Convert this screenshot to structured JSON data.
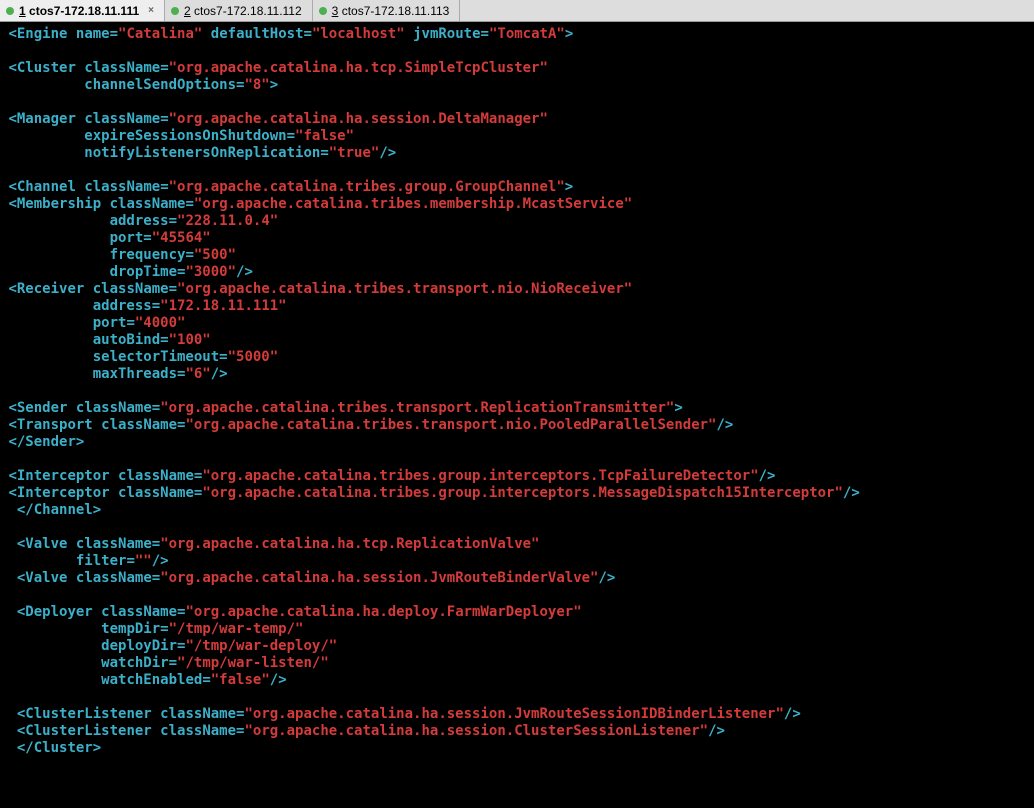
{
  "tabs": [
    {
      "num": "1",
      "label": "ctos7-172.18.11.111",
      "active": true,
      "close": true
    },
    {
      "num": "2",
      "label": "ctos7-172.18.11.112",
      "active": false,
      "close": false
    },
    {
      "num": "3",
      "label": "ctos7-172.18.11.113",
      "active": false,
      "close": false
    }
  ],
  "code": {
    "l01": {
      "tag": "Engine",
      "a1": "name",
      "v1": "\"Catalina\"",
      "a2": "defaultHost",
      "v2": "\"localhost\"",
      "a3": "jvmRoute",
      "v3": "\"TomcatA\""
    },
    "l03": {
      "tag": "Cluster",
      "a1": "className",
      "v1": "\"org.apache.catalina.ha.tcp.SimpleTcpCluster\""
    },
    "l04": {
      "a1": "channelSendOptions",
      "v1": "\"8\""
    },
    "l06": {
      "tag": "Manager",
      "a1": "className",
      "v1": "\"org.apache.catalina.ha.session.DeltaManager\""
    },
    "l07": {
      "a1": "expireSessionsOnShutdown",
      "v1": "\"false\""
    },
    "l08": {
      "a1": "notifyListenersOnReplication",
      "v1": "\"true\""
    },
    "l10": {
      "tag": "Channel",
      "a1": "className",
      "v1": "\"org.apache.catalina.tribes.group.GroupChannel\""
    },
    "l11": {
      "tag": "Membership",
      "a1": "className",
      "v1": "\"org.apache.catalina.tribes.membership.McastService\""
    },
    "l12": {
      "a1": "address",
      "v1": "\"228.11.0.4\""
    },
    "l13": {
      "a1": "port",
      "v1": "\"45564\""
    },
    "l14": {
      "a1": "frequency",
      "v1": "\"500\""
    },
    "l15": {
      "a1": "dropTime",
      "v1": "\"3000\""
    },
    "l16": {
      "tag": "Receiver",
      "a1": "className",
      "v1": "\"org.apache.catalina.tribes.transport.nio.NioReceiver\""
    },
    "l17": {
      "a1": "address",
      "v1": "\"172.18.11.111\""
    },
    "l18": {
      "a1": "port",
      "v1": "\"4000\""
    },
    "l19": {
      "a1": "autoBind",
      "v1": "\"100\""
    },
    "l20": {
      "a1": "selectorTimeout",
      "v1": "\"5000\""
    },
    "l21": {
      "a1": "maxThreads",
      "v1": "\"6\""
    },
    "l23": {
      "tag": "Sender",
      "a1": "className",
      "v1": "\"org.apache.catalina.tribes.transport.ReplicationTransmitter\""
    },
    "l24": {
      "tag": "Transport",
      "a1": "className",
      "v1": "\"org.apache.catalina.tribes.transport.nio.PooledParallelSender\""
    },
    "l25": {
      "tag": "/Sender"
    },
    "l27": {
      "tag": "Interceptor",
      "a1": "className",
      "v1": "\"org.apache.catalina.tribes.group.interceptors.TcpFailureDetector\""
    },
    "l28": {
      "tag": "Interceptor",
      "a1": "className",
      "v1": "\"org.apache.catalina.tribes.group.interceptors.MessageDispatch15Interceptor\""
    },
    "l29": {
      "tag": "/Channel"
    },
    "l31": {
      "tag": "Valve",
      "a1": "className",
      "v1": "\"org.apache.catalina.ha.tcp.ReplicationValve\""
    },
    "l32": {
      "a1": "filter",
      "v1": "\"\""
    },
    "l33": {
      "tag": "Valve",
      "a1": "className",
      "v1": "\"org.apache.catalina.ha.session.JvmRouteBinderValve\""
    },
    "l35": {
      "tag": "Deployer",
      "a1": "className",
      "v1": "\"org.apache.catalina.ha.deploy.FarmWarDeployer\""
    },
    "l36": {
      "a1": "tempDir",
      "v1": "\"/tmp/war-temp/\""
    },
    "l37": {
      "a1": "deployDir",
      "v1": "\"/tmp/war-deploy/\""
    },
    "l38": {
      "a1": "watchDir",
      "v1": "\"/tmp/war-listen/\""
    },
    "l39": {
      "a1": "watchEnabled",
      "v1": "\"false\""
    },
    "l41": {
      "tag": "ClusterListener",
      "a1": "className",
      "v1": "\"org.apache.catalina.ha.session.JvmRouteSessionIDBinderListener\""
    },
    "l42": {
      "tag": "ClusterListener",
      "a1": "className",
      "v1": "\"org.apache.catalina.ha.session.ClusterSessionListener\""
    },
    "l43": {
      "tag": "/Cluster"
    }
  }
}
